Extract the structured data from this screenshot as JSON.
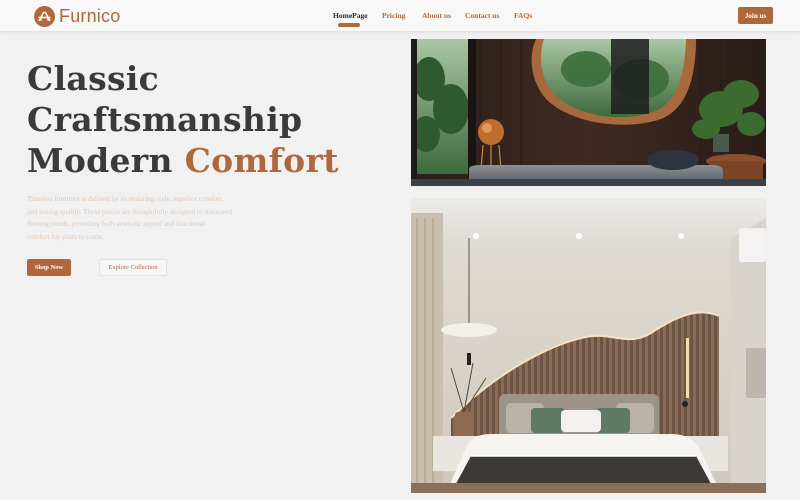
{
  "brand": {
    "name": "Furnico",
    "accent": "#b0683b"
  },
  "nav": {
    "links": [
      "HomePage",
      "Pricing",
      "About us",
      "Contact us",
      "FAQs"
    ],
    "active": "HomePage",
    "cta": "Join us"
  },
  "hero": {
    "line1": "Classic",
    "line2": "Craftsmanship",
    "line3_dark": "Modern",
    "line3_accent": "Comfort",
    "description_lines": [
      "Timeless furniture is defined by its enduring style, superior comfort,",
      "and lasting quality. These pieces are thoughtfully designed to transcend",
      "fleeting trends, providing both aesthetic appeal and functional",
      "comfort for years to come."
    ],
    "primary_button": "Shop Now",
    "secondary_button": "Explore Collection"
  },
  "images": {
    "top": "living-room-mirror-photo",
    "bottom": "bedroom-photo"
  }
}
